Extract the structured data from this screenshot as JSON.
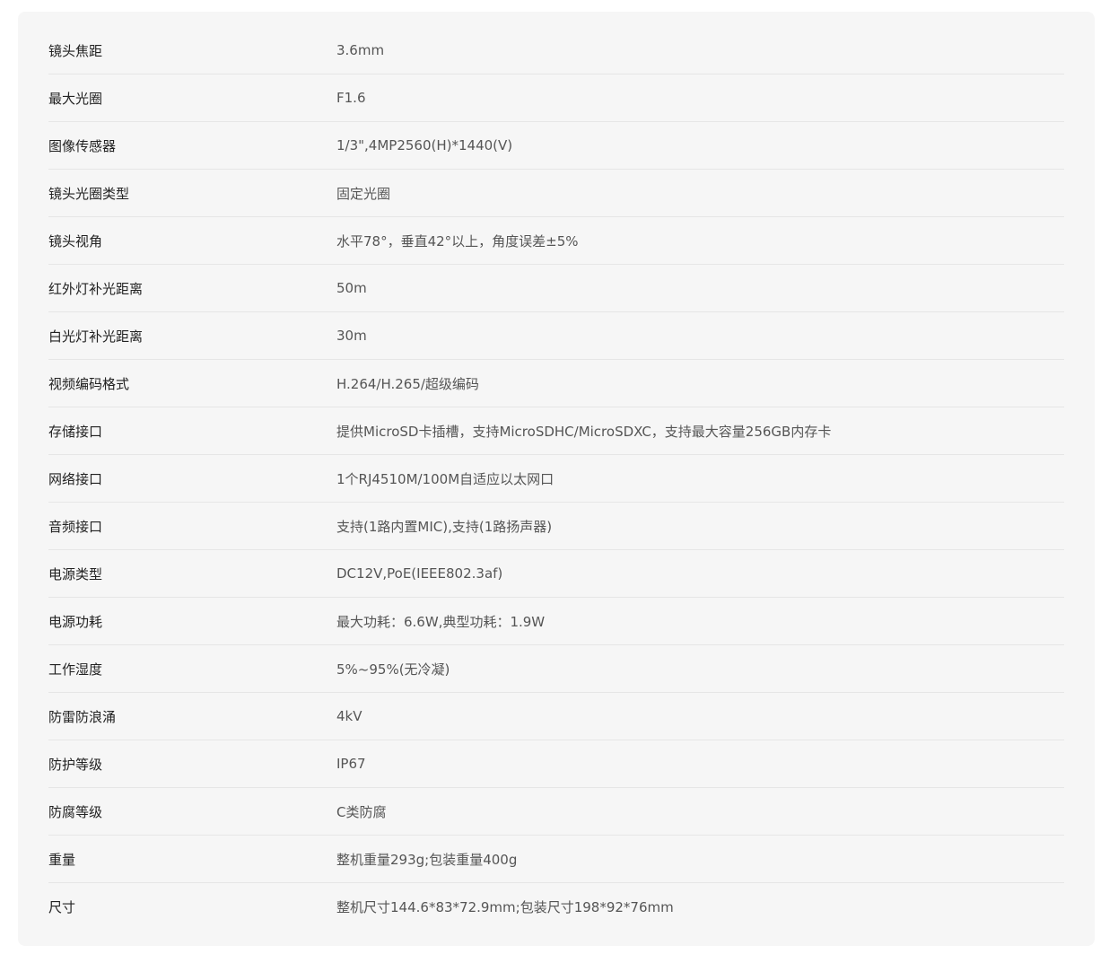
{
  "specs": [
    {
      "label": "镜头焦距",
      "value": "3.6mm"
    },
    {
      "label": "最大光圈",
      "value": "F1.6"
    },
    {
      "label": "图像传感器",
      "value": "1/3\",4MP2560(H)*1440(V)"
    },
    {
      "label": "镜头光圈类型",
      "value": "固定光圈"
    },
    {
      "label": "镜头视角",
      "value": "水平78°，垂直42°以上，角度误差±5%"
    },
    {
      "label": "红外灯补光距离",
      "value": "50m"
    },
    {
      "label": "白光灯补光距离",
      "value": "30m"
    },
    {
      "label": "视频编码格式",
      "value": "H.264/H.265/超级编码"
    },
    {
      "label": "存储接口",
      "value": "提供MicroSD卡插槽，支持MicroSDHC/MicroSDXC，支持最大容量256GB内存卡"
    },
    {
      "label": "网络接口",
      "value": "1个RJ4510M/100M自适应以太网口"
    },
    {
      "label": "音频接口",
      "value": "支持(1路内置MIC),支持(1路扬声器)"
    },
    {
      "label": "电源类型",
      "value": "DC12V,PoE(IEEE802.3af)"
    },
    {
      "label": "电源功耗",
      "value": "最大功耗：6.6W,典型功耗：1.9W"
    },
    {
      "label": "工作湿度",
      "value": "5%~95%(无冷凝)"
    },
    {
      "label": "防雷防浪涌",
      "value": "4kV"
    },
    {
      "label": "防护等级",
      "value": "IP67"
    },
    {
      "label": "防腐等级",
      "value": "C类防腐"
    },
    {
      "label": "重量",
      "value": "整机重量293g;包装重量400g"
    },
    {
      "label": "尺寸",
      "value": "整机尺寸144.6*83*72.9mm;包装尺寸198*92*76mm"
    }
  ]
}
